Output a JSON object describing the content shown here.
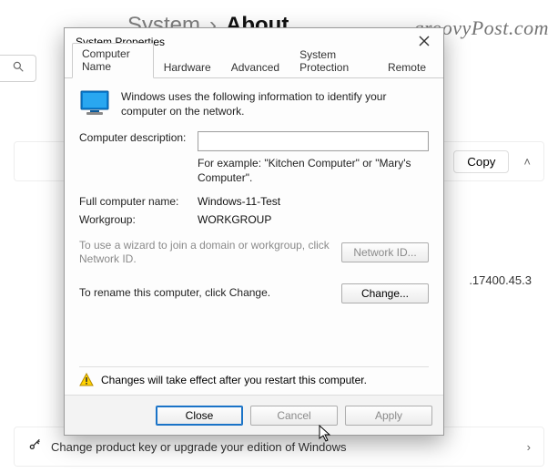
{
  "watermark": "groovyPost.com",
  "breadcrumb": {
    "parent": "System",
    "sep": "›",
    "active": "About"
  },
  "bg": {
    "copy_label": "Copy",
    "chev_up": "˄",
    "chev_right": "›",
    "ip_fragment": ".17400.45.3",
    "product_row": "Change product key or upgrade your edition of Windows"
  },
  "dialog": {
    "title": "System Properties",
    "tabs": [
      "Computer Name",
      "Hardware",
      "Advanced",
      "System Protection",
      "Remote"
    ],
    "active_tab": 0,
    "intro": "Windows uses the following information to identify your computer on the network.",
    "desc_label": "Computer description:",
    "desc_value": "",
    "desc_hint": "For example: \"Kitchen Computer\" or \"Mary's Computer\".",
    "fullname_label": "Full computer name:",
    "fullname_value": "Windows-11-Test",
    "workgroup_label": "Workgroup:",
    "workgroup_value": "WORKGROUP",
    "wizard_msg": "To use a wizard to join a domain or workgroup, click Network ID.",
    "network_id_btn": "Network ID...",
    "rename_msg": "To rename this computer, click Change.",
    "change_btn": "Change...",
    "restart_msg": "Changes will take effect after you restart this computer.",
    "buttons": {
      "close": "Close",
      "cancel": "Cancel",
      "apply": "Apply"
    }
  }
}
